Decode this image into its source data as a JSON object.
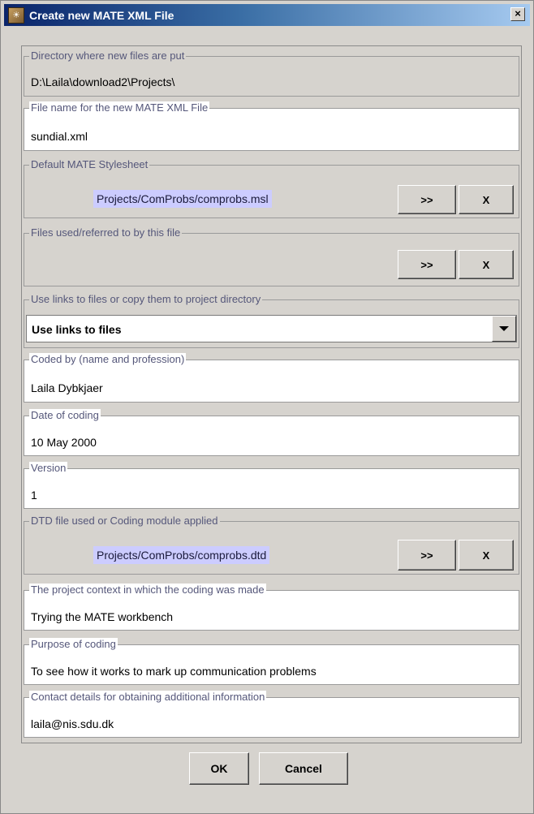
{
  "window": {
    "title": "Create new MATE XML File"
  },
  "fields": {
    "directory": {
      "legend": "Directory where new files are put",
      "value": "D:\\Laila\\download2\\Projects\\"
    },
    "filename": {
      "legend": "File name for the new MATE XML File",
      "value": "sundial.xml"
    },
    "stylesheet": {
      "legend": "Default MATE Stylesheet",
      "value": "Projects/ComProbs/comprobs.msl",
      "browse": ">>",
      "clear": "X"
    },
    "referred": {
      "legend": "Files used/referred to by this file",
      "browse": ">>",
      "clear": "X"
    },
    "links": {
      "legend": "Use links to files or copy them to project directory",
      "selected": "Use links to files"
    },
    "coded_by": {
      "legend": "Coded by (name and profession)",
      "value": "Laila Dybkjaer"
    },
    "date": {
      "legend": "Date of coding",
      "value": "10 May 2000"
    },
    "version": {
      "legend": "Version",
      "value": "1"
    },
    "dtd": {
      "legend": "DTD file used or Coding module applied",
      "value": "Projects/ComProbs/comprobs.dtd",
      "browse": ">>",
      "clear": "X"
    },
    "context": {
      "legend": "The project context in which the coding was made",
      "value": "Trying the MATE workbench"
    },
    "purpose": {
      "legend": "Purpose of coding",
      "value": "To see how it works to mark up communication problems"
    },
    "contact": {
      "legend": "Contact details for obtaining additional information",
      "value": "laila@nis.sdu.dk"
    }
  },
  "buttons": {
    "ok": "OK",
    "cancel": "Cancel"
  },
  "colors": {
    "title_start": "#0a246a",
    "title_end": "#a6caf0",
    "legend_text": "#55577a",
    "chip_bg": "#ccccff",
    "window_bg": "#d6d3ce"
  }
}
